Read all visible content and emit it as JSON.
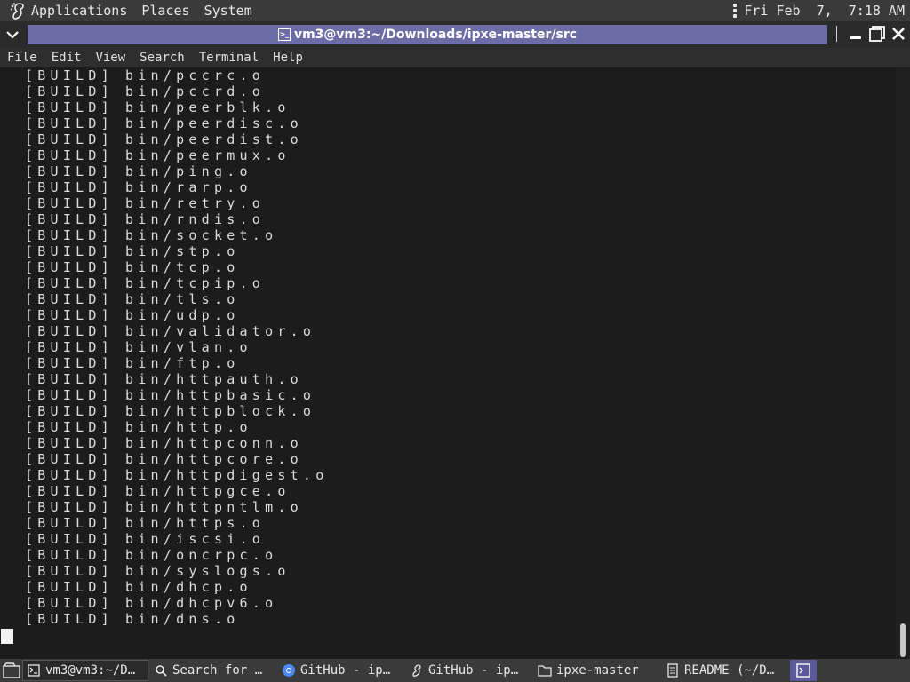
{
  "top_panel": {
    "menus": [
      "Applications",
      "Places",
      "System"
    ],
    "clock": "Fri Feb  7,  7:18 AM"
  },
  "window": {
    "title": "vm3@vm3:~/Downloads/ipxe-master/src"
  },
  "menu_bar": [
    "File",
    "Edit",
    "View",
    "Search",
    "Terminal",
    "Help"
  ],
  "terminal": {
    "tag": "[BUILD]",
    "lines": [
      "bin/pccrc.o",
      "bin/pccrd.o",
      "bin/peerblk.o",
      "bin/peerdisc.o",
      "bin/peerdist.o",
      "bin/peermux.o",
      "bin/ping.o",
      "bin/rarp.o",
      "bin/retry.o",
      "bin/rndis.o",
      "bin/socket.o",
      "bin/stp.o",
      "bin/tcp.o",
      "bin/tcpip.o",
      "bin/tls.o",
      "bin/udp.o",
      "bin/validator.o",
      "bin/vlan.o",
      "bin/ftp.o",
      "bin/httpauth.o",
      "bin/httpbasic.o",
      "bin/httpblock.o",
      "bin/http.o",
      "bin/httpconn.o",
      "bin/httpcore.o",
      "bin/httpdigest.o",
      "bin/httpgce.o",
      "bin/httpntlm.o",
      "bin/https.o",
      "bin/iscsi.o",
      "bin/oncrpc.o",
      "bin/syslogs.o",
      "bin/dhcp.o",
      "bin/dhcpv6.o",
      "bin/dns.o"
    ]
  },
  "taskbar": {
    "items": [
      {
        "label": "vm3@vm3:~/D…",
        "icon": "terminal-icon"
      },
      {
        "label": "Search for …",
        "icon": "search-icon"
      },
      {
        "label": "GitHub - ip…",
        "icon": "chrome-icon"
      },
      {
        "label": "GitHub - ip…",
        "icon": "gnome-foot-icon"
      },
      {
        "label": "ipxe-master",
        "icon": "folder-icon"
      },
      {
        "label": "README (~/D…",
        "icon": "document-icon"
      }
    ]
  },
  "colors": {
    "title_bar": "#6d6da6",
    "panel": "#3a3a3a",
    "terminal_bg": "#1c1c1c"
  }
}
